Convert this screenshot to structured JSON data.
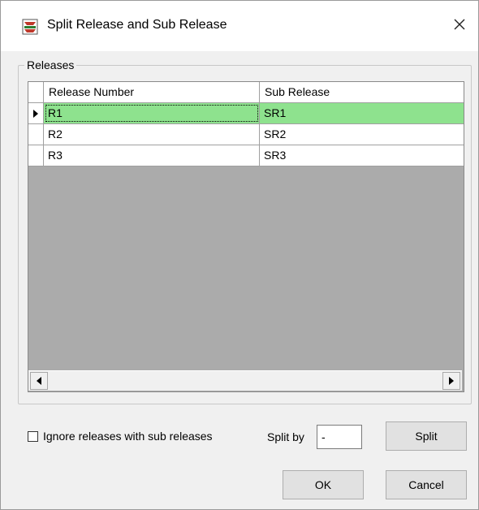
{
  "window": {
    "title": "Split Release and Sub Release",
    "icon": "app-logo-icon",
    "close_icon": "close-icon"
  },
  "group": {
    "label": "Releases"
  },
  "grid": {
    "columns": [
      "Release Number",
      "Sub Release"
    ],
    "rows": [
      {
        "release": "R1",
        "sub": "SR1",
        "selected": true
      },
      {
        "release": "R2",
        "sub": "SR2",
        "selected": false
      },
      {
        "release": "R3",
        "sub": "SR3",
        "selected": false
      }
    ],
    "selected_color": "#8ee28e"
  },
  "options": {
    "ignore_label": "Ignore releases with sub releases",
    "ignore_checked": false,
    "split_by_label": "Split by",
    "split_by_value": "-"
  },
  "buttons": {
    "split": "Split",
    "ok": "OK",
    "cancel": "Cancel"
  }
}
